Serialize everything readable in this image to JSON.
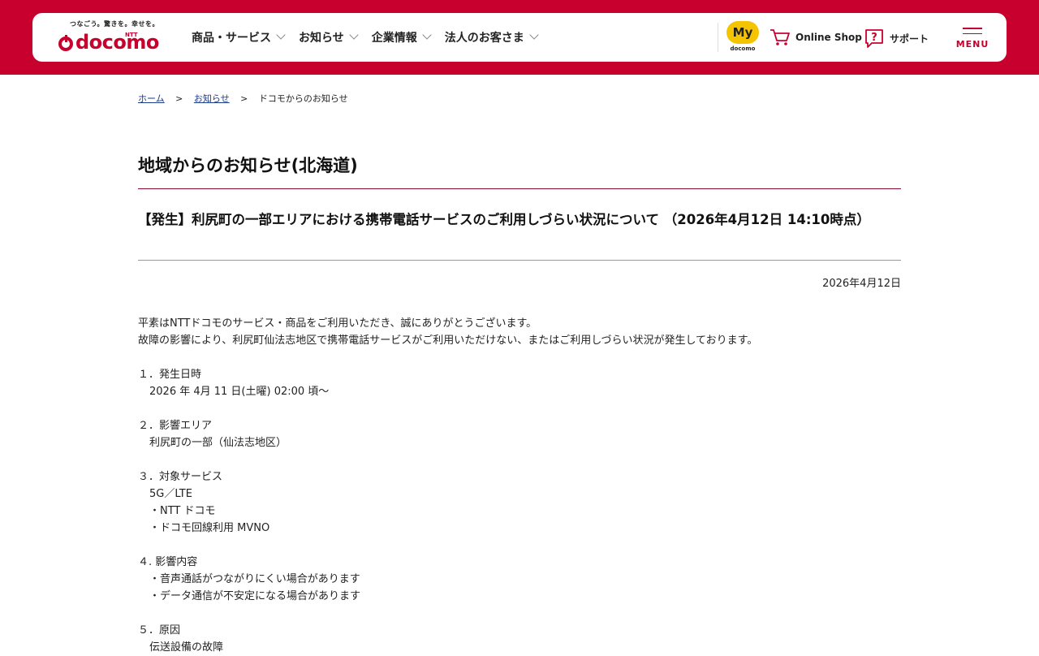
{
  "header": {
    "logo_tagline": "つなごう。驚きを。幸せを。",
    "logo_ntt": "NTT",
    "logo_text": "docomo",
    "nav": [
      "商品・サービス",
      "お知らせ",
      "企業情報",
      "法人のお客さま"
    ],
    "my_label": "My",
    "my_sub": "docomo",
    "online_shop": "Online Shop",
    "support": "サポート",
    "menu": "MENU"
  },
  "colors": {
    "brand": "#c8002e",
    "my_yellow": "#f5c400",
    "link": "#1a3a8a"
  },
  "breadcrumb": {
    "home": "ホーム",
    "news": "お知らせ",
    "current": "ドコモからのお知らせ",
    "sep": ">"
  },
  "page_title": "地域からのお知らせ(北海道)",
  "article_title": "【発生】利尻町の一部エリアにおける携帯電話サービスのご利用しづらい状況について （2026年4月12日 14:10時点）",
  "date": "2026年4月12日",
  "intro": [
    "平素はNTTドコモのサービス・商品をご利用いただき、誠にありがとうございます。",
    "故障の影響により、利尻町仙法志地区で携帯電話サービスがご利用いただけない、またはご利用しづらい状況が発生しております。"
  ],
  "sections": [
    {
      "heading": "１．発生日時",
      "lines": [
        "2026 年 4月 11 日(土曜) 02:00 頃～"
      ]
    },
    {
      "heading": "２．影響エリア",
      "lines": [
        "利尻町の一部（仙法志地区）"
      ]
    },
    {
      "heading": "３．対象サービス",
      "lines": [
        "5G／LTE",
        "・NTT ドコモ",
        "・ドコモ回線利用 MVNO"
      ]
    },
    {
      "heading": "４. 影響内容",
      "lines": [
        "・音声通話がつながりにくい場合があります",
        "・データ通信が不安定になる場合があります"
      ]
    },
    {
      "heading": "５．原因",
      "lines": [
        "伝送設備の故障"
      ]
    }
  ]
}
